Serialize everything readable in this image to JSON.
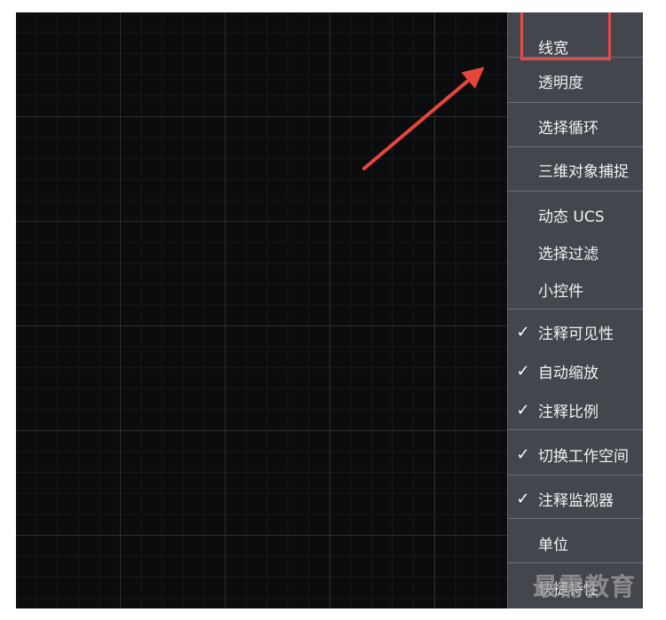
{
  "menu": {
    "items": [
      {
        "label": "线宽",
        "checked": false
      },
      {
        "label": "透明度",
        "checked": false
      },
      {
        "label": "选择循环",
        "checked": false
      },
      {
        "label": "三维对象捕捉",
        "checked": false
      },
      {
        "label": "动态 UCS",
        "checked": false
      },
      {
        "label": "选择过滤",
        "checked": false
      },
      {
        "label": "小控件",
        "checked": false
      },
      {
        "label": "注释可见性",
        "checked": true
      },
      {
        "label": "自动缩放",
        "checked": true
      },
      {
        "label": "注释比例",
        "checked": true
      },
      {
        "label": "切换工作空间",
        "checked": true
      },
      {
        "label": "注释监视器",
        "checked": true
      },
      {
        "label": "单位",
        "checked": false
      },
      {
        "label": "快捷特性",
        "checked": false
      }
    ],
    "check_glyph": "✓"
  },
  "watermark": "最需教育",
  "colors": {
    "canvas": "#0b0c0e",
    "menu_bg": "#43474d",
    "highlight": "#e24a4a"
  }
}
